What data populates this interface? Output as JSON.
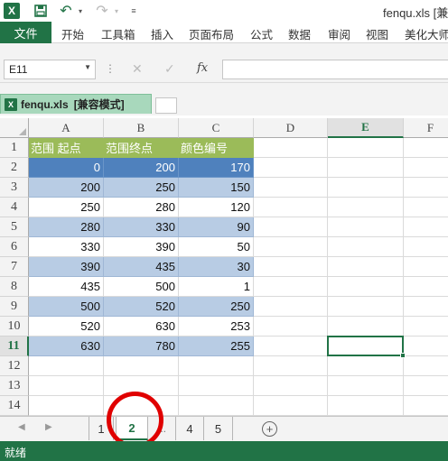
{
  "titlebar": {
    "app_icon": "X",
    "doc_title": "fenqu.xls  [兼",
    "icons": {
      "save": "save-icon",
      "undo": "undo-icon",
      "redo": "redo-icon",
      "dropdown": "chevron-down-icon",
      "customize": "customize-icon"
    }
  },
  "ribbon": {
    "file_label": "文件",
    "tabs": [
      "开始",
      "工具箱",
      "插入",
      "页面布局",
      "公式",
      "数据",
      "审阅",
      "视图",
      "美化大师"
    ]
  },
  "formula_bar": {
    "name_box": "E11",
    "formula": "",
    "fx_label": "fx",
    "cancel_glyph": "✕",
    "enter_glyph": "✓",
    "dots": "⋮"
  },
  "doc_tab": {
    "icon_letter": "X",
    "name": "fenqu.xls",
    "mode": "[兼容模式]"
  },
  "grid": {
    "columns": [
      "A",
      "B",
      "C",
      "D",
      "E",
      "F"
    ],
    "selected_column": "E",
    "rows": [
      "1",
      "2",
      "3",
      "4",
      "5",
      "6",
      "7",
      "8",
      "9",
      "10",
      "11",
      "12",
      "13",
      "14"
    ],
    "selected_row": "11",
    "header_row": [
      "范围 起点",
      "范围终点",
      "颜色编号"
    ],
    "data": [
      [
        "0",
        "200",
        "170"
      ],
      [
        "200",
        "250",
        "150"
      ],
      [
        "250",
        "280",
        "120"
      ],
      [
        "280",
        "330",
        "90"
      ],
      [
        "330",
        "390",
        "50"
      ],
      [
        "390",
        "435",
        "30"
      ],
      [
        "435",
        "500",
        "1"
      ],
      [
        "500",
        "520",
        "250"
      ],
      [
        "520",
        "630",
        "253"
      ],
      [
        "630",
        "780",
        "255"
      ]
    ],
    "active_cell": "E11",
    "colors": {
      "header": "#9bbb59",
      "first_row": "#4f81bd",
      "band": "#b8cce4",
      "accent": "#217346"
    }
  },
  "sheet_tabs": {
    "tabs": [
      "1",
      "2",
      "4",
      "5"
    ],
    "active": "2",
    "dots": "...",
    "nav_prev": "◀",
    "nav_next": "▶",
    "add_glyph": "+",
    "annotation_color": "#e00000"
  },
  "status": {
    "text": "就绪"
  }
}
